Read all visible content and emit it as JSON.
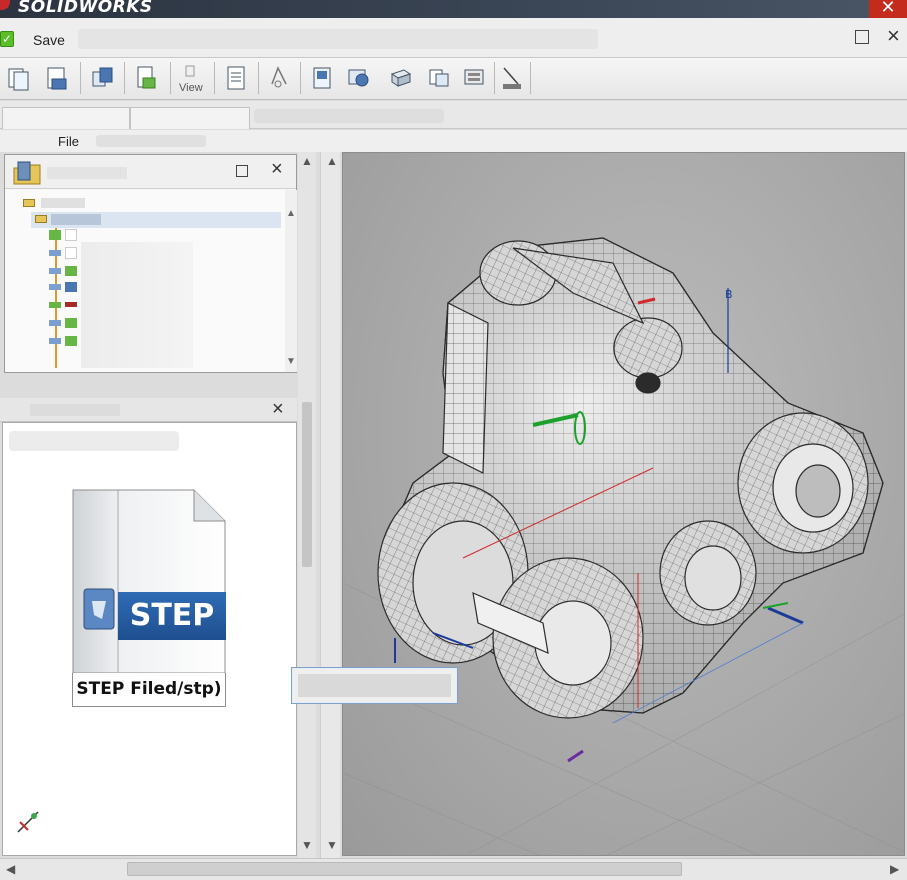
{
  "app": {
    "brand": "SOLIDWORKS",
    "window_close_glyph": "✕"
  },
  "saverow": {
    "save_label": "Save",
    "check_glyph": "✓"
  },
  "toolbar": {
    "view_label": "View"
  },
  "menubar": {
    "file_label": "File"
  },
  "preview": {
    "step_banner": "STEP",
    "step_caption": "STEP Filed/stp)"
  },
  "colors": {
    "accent_green": "#5cbf2a",
    "title_bar": "#2b3440",
    "close_red": "#c42b1c",
    "step_blue": "#2f6cb4"
  },
  "icons": {
    "toolbar": [
      "new-document-icon",
      "save-document-icon",
      "copy-icon",
      "paste-icon",
      "view-icon",
      "print-preview-icon",
      "rebuild-icon",
      "options-icon",
      "search-document-icon",
      "box-view-icon",
      "copy-view-icon",
      "screen-capture-icon",
      "sketch-icon"
    ],
    "tree": [
      "assembly-folder-icon",
      "part-icon",
      "part-icon",
      "part-icon",
      "part-icon",
      "part-icon",
      "part-icon",
      "part-icon",
      "part-icon"
    ]
  }
}
